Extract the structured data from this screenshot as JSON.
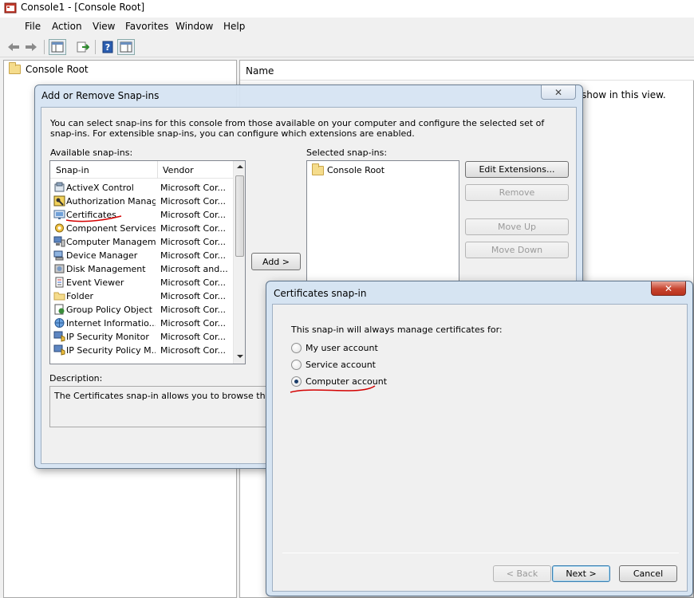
{
  "window": {
    "title": "Console1 - [Console Root]"
  },
  "menu": [
    "File",
    "Action",
    "View",
    "Favorites",
    "Window",
    "Help"
  ],
  "toolbar": {
    "icons": [
      "back-arrow-icon",
      "forward-arrow-icon",
      "show-hide-tree-icon",
      "export-list-icon",
      "help-icon",
      "properties-icon"
    ]
  },
  "tree": {
    "root": "Console Root"
  },
  "list": {
    "column_name": "Name",
    "empty_message": "show in this view."
  },
  "snapin_dialog": {
    "title": "Add or Remove Snap-ins",
    "intro": "You can select snap-ins for this console from those available on your computer and configure the selected set of snap-ins. For extensible snap-ins, you can configure which extensions are enabled.",
    "available_label": "Available snap-ins:",
    "selected_label": "Selected snap-ins:",
    "columns": {
      "snapin": "Snap-in",
      "vendor": "Vendor"
    },
    "rows": [
      {
        "name": "ActiveX Control",
        "vendor": "Microsoft Cor...",
        "icon": "activex-icon"
      },
      {
        "name": "Authorization Manager",
        "vendor": "Microsoft Cor...",
        "icon": "authorization-manager-icon"
      },
      {
        "name": "Certificates",
        "vendor": "Microsoft Cor...",
        "icon": "certificates-icon"
      },
      {
        "name": "Component Services",
        "vendor": "Microsoft Cor...",
        "icon": "component-services-icon"
      },
      {
        "name": "Computer Managem...",
        "vendor": "Microsoft Cor...",
        "icon": "computer-management-icon"
      },
      {
        "name": "Device Manager",
        "vendor": "Microsoft Cor...",
        "icon": "device-manager-icon"
      },
      {
        "name": "Disk Management",
        "vendor": "Microsoft and...",
        "icon": "disk-management-icon"
      },
      {
        "name": "Event Viewer",
        "vendor": "Microsoft Cor...",
        "icon": "event-viewer-icon"
      },
      {
        "name": "Folder",
        "vendor": "Microsoft Cor...",
        "icon": "folder-icon"
      },
      {
        "name": "Group Policy Object ...",
        "vendor": "Microsoft Cor...",
        "icon": "group-policy-icon"
      },
      {
        "name": "Internet Informatio...",
        "vendor": "Microsoft Cor...",
        "icon": "iis-icon"
      },
      {
        "name": "IP Security Monitor",
        "vendor": "Microsoft Cor...",
        "icon": "ip-security-monitor-icon"
      },
      {
        "name": "IP Security Policy M...",
        "vendor": "Microsoft Cor...",
        "icon": "ip-security-policy-icon"
      }
    ],
    "selected_items": [
      "Console Root"
    ],
    "add_button": "Add >",
    "edit_extensions": "Edit Extensions...",
    "remove": "Remove",
    "move_up": "Move Up",
    "move_down": "Move Down",
    "description_label": "Description:",
    "description_text": "The Certificates snap-in allows you to browse the conte"
  },
  "cert_dialog": {
    "title": "Certificates snap-in",
    "prompt": "This snap-in will always manage certificates for:",
    "options": [
      {
        "label": "My user account",
        "selected": false
      },
      {
        "label": "Service account",
        "selected": false
      },
      {
        "label": "Computer account",
        "selected": true
      }
    ],
    "back": "< Back",
    "next": "Next >",
    "cancel": "Cancel"
  },
  "colors": {
    "window_bg": "#f0f0f0",
    "dialog_frame": "#d6e4f2",
    "annotation_red": "#d40000",
    "close_red": "#c7442f"
  }
}
